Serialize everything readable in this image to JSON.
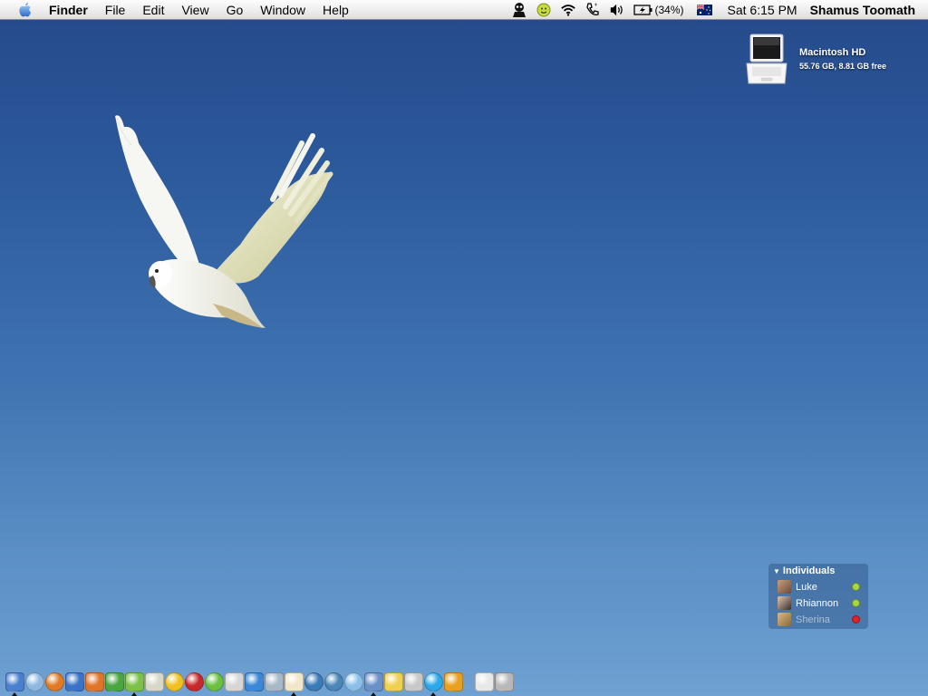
{
  "menubar": {
    "apple_icon": "apple-logo-icon",
    "menus": [
      {
        "label": "Finder",
        "bold": true
      },
      {
        "label": "File",
        "bold": false
      },
      {
        "label": "Edit",
        "bold": false
      },
      {
        "label": "View",
        "bold": false
      },
      {
        "label": "Go",
        "bold": false
      },
      {
        "label": "Window",
        "bold": false
      },
      {
        "label": "Help",
        "bold": false
      }
    ],
    "tray": {
      "alien_icon": "alien-icon",
      "adium_icon": "adium-duck-icon",
      "wifi_icon": "wifi-icon",
      "phone_icon": "phone-icon",
      "volume_icon": "volume-icon",
      "battery_icon": "battery-charging-icon",
      "battery_percent": "(34%)",
      "flag_icon": "australia-flag-icon",
      "clock": "Sat 6:15 PM",
      "user": "Shamus Toomath"
    }
  },
  "desktop": {
    "drive": {
      "name": "Macintosh HD",
      "info": "55.76 GB, 8.81 GB free"
    }
  },
  "buddy_list": {
    "group": "Individuals",
    "buddies": [
      {
        "name": "Luke",
        "status": "available",
        "status_color": "#a8d93c"
      },
      {
        "name": "Rhiannon",
        "status": "available",
        "status_color": "#a8d93c"
      },
      {
        "name": "Sherina",
        "status": "away",
        "status_color": "#e0222a"
      }
    ]
  },
  "dock": {
    "apps": [
      {
        "name": "finder-icon",
        "color": "#4a7fd0",
        "running": true
      },
      {
        "name": "safari-icon",
        "color": "#8fb8e0",
        "running": false
      },
      {
        "name": "firefox-icon",
        "color": "#e07a24",
        "running": false
      },
      {
        "name": "word-icon",
        "color": "#3b73c8",
        "running": false
      },
      {
        "name": "powerpoint-icon",
        "color": "#e0752a",
        "running": false
      },
      {
        "name": "dreamweaver-icon",
        "color": "#4aa640",
        "running": false
      },
      {
        "name": "itunes-icon",
        "color": "#7cc24a",
        "running": true
      },
      {
        "name": "textedit-icon",
        "color": "#d8d8c8",
        "running": false
      },
      {
        "name": "fireworks-icon",
        "color": "#f0c020",
        "running": false
      },
      {
        "name": "flash-icon",
        "color": "#c8282a",
        "running": false
      },
      {
        "name": "dreamweaver-green-icon",
        "color": "#6ac040",
        "running": false
      },
      {
        "name": "ichat-icon",
        "color": "#d6d6d6",
        "running": false
      },
      {
        "name": "mail-icon",
        "color": "#3a88d8",
        "running": false
      },
      {
        "name": "preview-icon",
        "color": "#a8b8c8",
        "running": false
      },
      {
        "name": "adium-icon",
        "color": "#f0e6c8",
        "running": true
      },
      {
        "name": "globe-icon",
        "color": "#3a7ab8",
        "running": false
      },
      {
        "name": "network-globe-icon",
        "color": "#4a86b8",
        "running": false
      },
      {
        "name": "omni-icon",
        "color": "#8ac0e8",
        "running": false
      },
      {
        "name": "iphoto-icon",
        "color": "#6a90c8",
        "running": true
      },
      {
        "name": "stickies-icon",
        "color": "#f0d050",
        "running": false
      },
      {
        "name": "dictionary-icon",
        "color": "#c8c8c8",
        "running": false
      },
      {
        "name": "skype-icon",
        "color": "#2aa8e8",
        "running": true
      },
      {
        "name": "transmit-icon",
        "color": "#e8a020",
        "running": false
      },
      {
        "name": "mail-stack-icon",
        "color": "#e8e8e8",
        "running": false
      },
      {
        "name": "trash-icon",
        "color": "#b8b8b8",
        "running": false
      }
    ]
  }
}
